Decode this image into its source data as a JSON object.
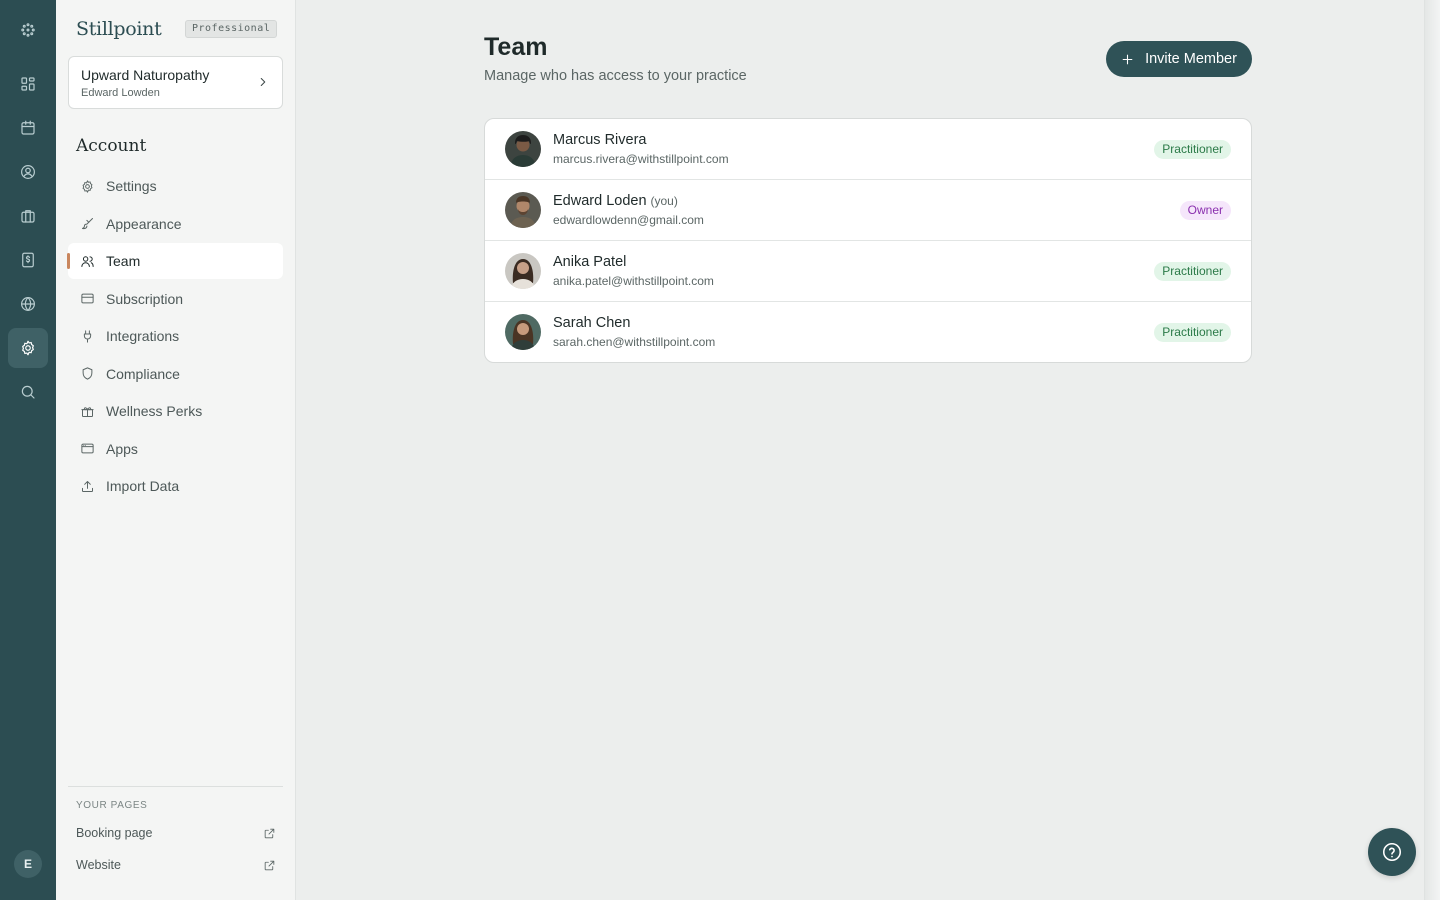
{
  "rail": {
    "items": [
      {
        "name": "logo-icon"
      },
      {
        "name": "dashboard-icon"
      },
      {
        "name": "calendar-icon"
      },
      {
        "name": "clients-icon"
      },
      {
        "name": "services-icon"
      },
      {
        "name": "billing-icon"
      },
      {
        "name": "website-icon"
      },
      {
        "name": "settings-icon",
        "active": true
      },
      {
        "name": "search-icon"
      }
    ],
    "avatar_initial": "E"
  },
  "sidebar": {
    "brand": "Stillpoint",
    "plan": "Professional",
    "practice": {
      "name": "Upward Naturopathy",
      "user": "Edward Lowden"
    },
    "section_title": "Account",
    "items": [
      {
        "label": "Settings",
        "icon": "gear-icon"
      },
      {
        "label": "Appearance",
        "icon": "brush-icon"
      },
      {
        "label": "Team",
        "icon": "users-icon",
        "active": true
      },
      {
        "label": "Subscription",
        "icon": "credit-card-icon"
      },
      {
        "label": "Integrations",
        "icon": "plug-icon"
      },
      {
        "label": "Compliance",
        "icon": "shield-icon"
      },
      {
        "label": "Wellness Perks",
        "icon": "gift-icon"
      },
      {
        "label": "Apps",
        "icon": "app-window-icon"
      },
      {
        "label": "Import Data",
        "icon": "upload-icon"
      }
    ],
    "pages_title": "YOUR PAGES",
    "pages": [
      {
        "label": "Booking page"
      },
      {
        "label": "Website"
      }
    ]
  },
  "main": {
    "title": "Team",
    "subtitle": "Manage who has access to your practice",
    "invite_label": "Invite Member",
    "members": [
      {
        "name": "Marcus Rivera",
        "you": "",
        "email": "marcus.rivera@withstillpoint.com",
        "role": "Practitioner"
      },
      {
        "name": "Edward Loden",
        "you": "(you)",
        "email": "edwardlowdenn@gmail.com",
        "role": "Owner"
      },
      {
        "name": "Anika Patel",
        "you": "",
        "email": "anika.patel@withstillpoint.com",
        "role": "Practitioner"
      },
      {
        "name": "Sarah Chen",
        "you": "",
        "email": "sarah.chen@withstillpoint.com",
        "role": "Practitioner"
      }
    ]
  },
  "colors": {
    "rail": "#2c4d52",
    "accent": "#c9865d",
    "primary_button": "#2f5257",
    "practitioner_badge": "#2b7a48",
    "owner_badge": "#8a2fae"
  }
}
